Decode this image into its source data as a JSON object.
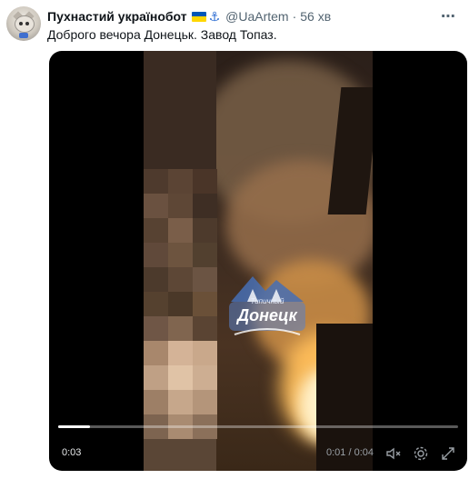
{
  "tweet": {
    "author_name": "Пухнастий українобот",
    "handle": "@UaArtem",
    "separator": "·",
    "time_ago": "56 хв",
    "text": "Доброго вечора Донецьк. Завод Топаз.",
    "more_glyph": "⋯",
    "anchor_glyph": "⚓"
  },
  "video": {
    "current_time": "0:03",
    "duration": "0:01 / 0:04",
    "progress": 0.08,
    "watermark_line1": "Типичный",
    "watermark_line2": "Донецк",
    "icons": [
      "mute-icon",
      "settings-icon",
      "fullscreen-icon"
    ]
  },
  "colors": {
    "text": "#0f1419",
    "muted": "#536471",
    "flag_blue": "#0057b7",
    "flag_yellow": "#ffd700"
  }
}
